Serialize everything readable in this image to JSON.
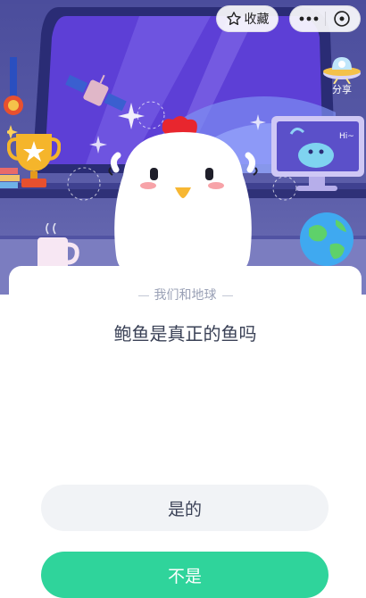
{
  "toolbar": {
    "favorite_label": "收藏",
    "share_label": "分享"
  },
  "scene": {
    "robot_text": "Hi~"
  },
  "quiz": {
    "category": "我们和地球",
    "question": "鲍鱼是真正的鱼吗",
    "options": [
      {
        "label": "是的"
      },
      {
        "label": "不是"
      }
    ]
  },
  "colors": {
    "accent": "#2fd49b",
    "scene_background": "#5a5ca8",
    "text_primary": "#3a4156",
    "text_muted": "#9aa1b6"
  }
}
